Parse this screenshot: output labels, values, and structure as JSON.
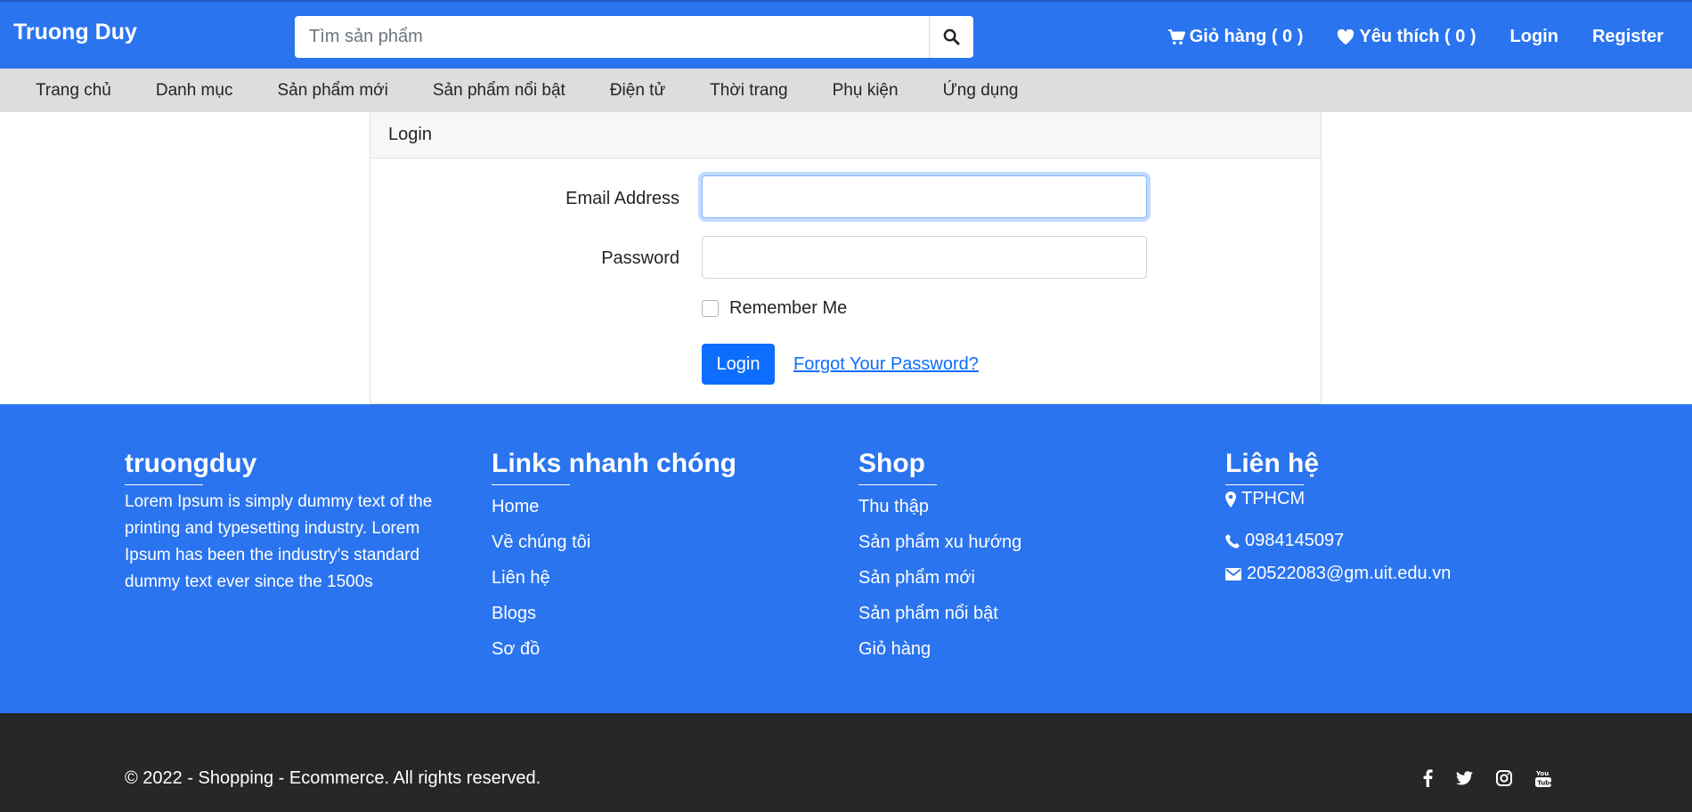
{
  "header": {
    "brand": "Truong Duy",
    "search_placeholder": "Tìm sản phẩm",
    "cart_label": "Giỏ hàng ( 0 )",
    "wishlist_label": "Yêu thích ( 0 )",
    "login_label": "Login",
    "register_label": "Register"
  },
  "nav": {
    "items": [
      "Trang chủ",
      "Danh mục",
      "Sản phẩm mới",
      "Sản phẩm nổi bật",
      "Điện tử",
      "Thời trang",
      "Phụ kiện",
      "Ứng dụng"
    ]
  },
  "login_card": {
    "title": "Login",
    "email_label": "Email Address",
    "email_value": "",
    "password_label": "Password",
    "password_value": "",
    "remember_label": "Remember Me",
    "remember_checked": false,
    "submit_label": "Login",
    "forgot_label": "Forgot Your Password?"
  },
  "footer": {
    "about": {
      "heading": "truongduy",
      "text": "Lorem Ipsum is simply dummy text of the printing and typesetting industry. Lorem Ipsum has been the industry's standard dummy text ever since the 1500s"
    },
    "quick_links": {
      "heading": "Links nhanh chóng",
      "links": [
        "Home",
        "Về chúng tôi",
        "Liên hệ",
        "Blogs",
        "Sơ đồ"
      ]
    },
    "shop": {
      "heading": "Shop",
      "links": [
        "Thu thập",
        "Sản phẩm xu hướng",
        "Sản phẩm mới",
        "Sản phẩm nổi bật",
        "Giỏ hàng"
      ]
    },
    "contact": {
      "heading": "Liên hệ",
      "address": "TPHCM",
      "phone": "0984145097",
      "email": "20522083@gm.uit.edu.vn"
    }
  },
  "bottom_bar": {
    "copyright": "© 2022 - Shopping - Ecommerce. All rights reserved.",
    "social_icons": [
      "facebook-icon",
      "twitter-icon",
      "instagram-icon",
      "youtube-icon"
    ]
  },
  "colors": {
    "primary": "#2a74ef",
    "button": "#0d6efd",
    "dark": "#272727",
    "nav_bg": "#dddddd"
  }
}
